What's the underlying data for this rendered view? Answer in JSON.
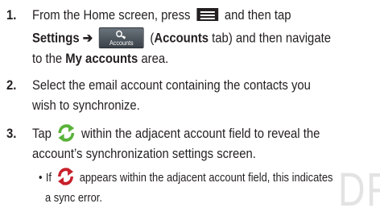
{
  "watermark": "DR",
  "steps": [
    {
      "number": "1.",
      "t_intro": "From the Home screen, press",
      "t_and_tap": "and then tap",
      "t_settings_arrow": "Settings ➔",
      "t_paren_open": "(",
      "t_accounts_tab": "Accounts",
      "t_tab_and_nav": "tab) and then navigate",
      "t_to_the": "to the",
      "t_my_accounts": "My accounts",
      "t_area": "area.",
      "menu_icon": "menu-icon",
      "accounts_icon_label": "Accounts"
    },
    {
      "number": "2.",
      "line1": "Select the email account containing the contacts you",
      "line2": "wish to synchronize."
    },
    {
      "number": "3.",
      "t_tap": "Tap",
      "t_within": "within the adjacent account field to reveal the",
      "line2": "account’s synchronization settings screen.",
      "sync_icon": "sync-icon"
    }
  ],
  "sub_bullet": {
    "bullet": "•",
    "t_if": "If",
    "t_appears": "appears within the adjacent account field, this indicates",
    "line2": "a sync error.",
    "sync_error_icon": "sync-error-icon"
  },
  "colors": {
    "text": "#231f20",
    "sync_green": "#5ab23a",
    "sync_red": "#c8202a",
    "watermark": "#e3e3e3"
  }
}
